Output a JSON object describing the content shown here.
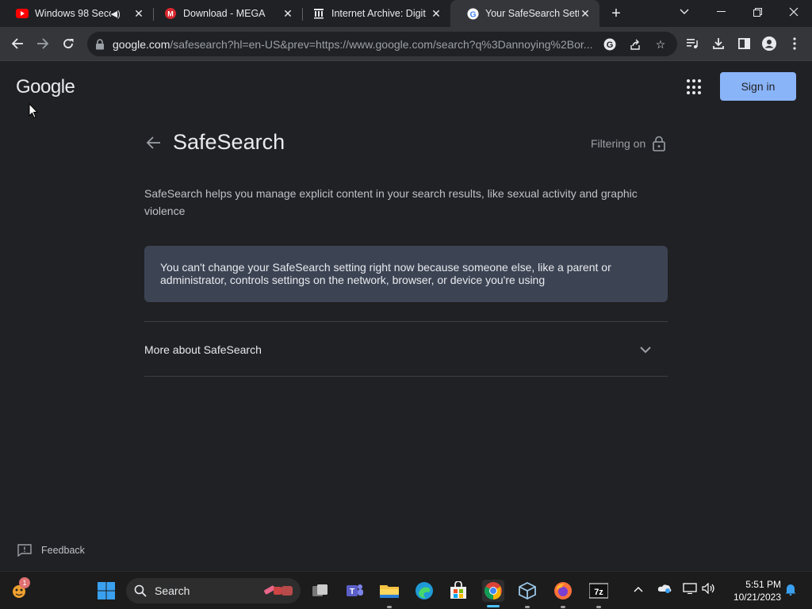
{
  "tabs": [
    {
      "title": "Windows 98 Seco",
      "favicon": "youtube-icon",
      "audio": true
    },
    {
      "title": "Download - MEGA",
      "favicon": "mega-icon"
    },
    {
      "title": "Internet Archive: Digit",
      "favicon": "archive-icon"
    },
    {
      "title": "Your SafeSearch Settin",
      "favicon": "google-icon",
      "active": true
    }
  ],
  "toolbar": {
    "url_host": "google.com",
    "url_path": "/safesearch?hl=en-US&prev=https://www.google.com/search?q%3Dannoying%2Bor..."
  },
  "page": {
    "logo": "Google",
    "signin_label": "Sign in",
    "title": "SafeSearch",
    "filtering_label": "Filtering on",
    "description": "SafeSearch helps you manage explicit content in your search results, like sexual activity and graphic violence",
    "notice": "You can't change your SafeSearch setting right now because someone else, like a parent or administrator, controls settings on the network, browser, or device you're using",
    "more_label": "More about SafeSearch",
    "feedback_label": "Feedback"
  },
  "taskbar": {
    "search_label": "Search",
    "widget_badge": "1",
    "time": "5:51 PM",
    "date": "10/21/2023",
    "apps": [
      "start-icon",
      "task-view-icon",
      "teams-icon",
      "file-explorer-icon",
      "edge-icon",
      "store-icon",
      "chrome-icon",
      "virtualbox-icon",
      "firefox-icon",
      "7zip-icon"
    ]
  },
  "colors": {
    "page_bg": "#202124",
    "accent": "#8ab4f8",
    "notice_bg": "#3c4454",
    "toolbar_bg": "#35363a"
  }
}
